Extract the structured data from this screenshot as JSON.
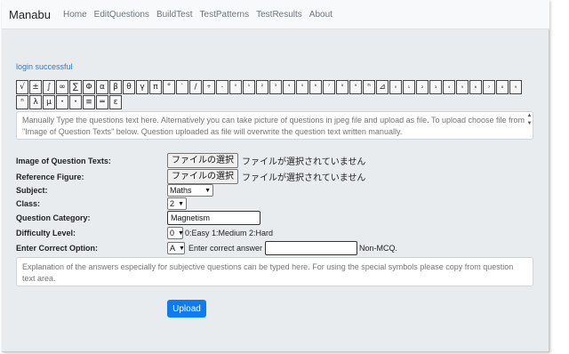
{
  "nav": {
    "brand": "Manabu",
    "links": [
      "Home",
      "EditQuestions",
      "BuildTest",
      "TestPatterns",
      "TestResults",
      "About"
    ]
  },
  "status": "login successful",
  "symbols": [
    "√",
    "±",
    "∫",
    "∞",
    "∑",
    "Φ",
    "α",
    "β",
    "θ",
    "γ",
    "π",
    "°",
    "`",
    "/",
    "+",
    "-",
    "⁰",
    "¹",
    "²",
    "³",
    "⁴",
    "⁵",
    "⁶",
    "⁷",
    "⁸",
    "⁹",
    "ⁿ",
    "⊿",
    "₀",
    "₁",
    "₂",
    "₃",
    "₄",
    "₅",
    "₆",
    "₇",
    "₈",
    "₉",
    "ⁿ",
    "λ",
    "μ",
    "•",
    "•",
    "≡",
    "═",
    "ε"
  ],
  "question_text": {
    "placeholder": "Manually Type the questions text here. Alternatively you can take picture of questions in jpeg file and upload as file. To upload choose file from \"Image of Question Texts\" below. Question uploaded as file will overwrite the question text written manually."
  },
  "form": {
    "image_label": "Image of Question Texts:",
    "reference_label": "Reference Figure:",
    "file_button": "ファイルの選択",
    "file_status": "ファイルが選択されていません",
    "subject_label": "Subject:",
    "subject_value": "Maths",
    "class_label": "Class:",
    "class_value": "2",
    "category_label": "Question Category:",
    "category_value": "Magnetism",
    "difficulty_label": "Difficulty Level:",
    "difficulty_value": "0",
    "difficulty_hint": "0:Easy 1:Medium 2:Hard",
    "option_label": "Enter Correct Option:",
    "option_value": "A",
    "answer_hint": "Enter correct answer",
    "answer_value": "",
    "nonmcq": "Non-MCQ."
  },
  "explanation": {
    "placeholder": "Explanation of the answers especially for subjective questions can be typed here. For using the special symbols please copy from question text area."
  },
  "upload_label": "Upload"
}
